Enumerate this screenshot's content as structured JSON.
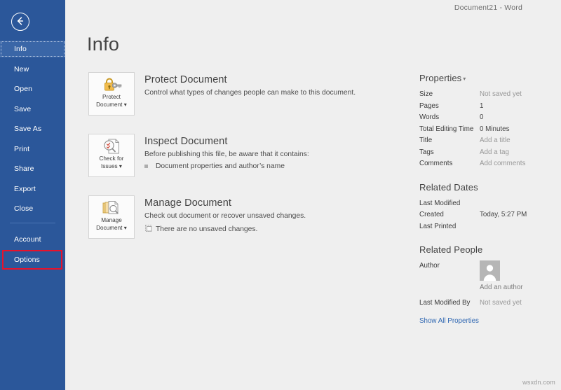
{
  "window": {
    "title": "Document21  -  Word"
  },
  "sidebar": {
    "back_icon": "back-arrow-icon",
    "items": [
      {
        "label": "Info",
        "selected": true
      },
      {
        "label": "New",
        "selected": false
      },
      {
        "label": "Open",
        "selected": false
      },
      {
        "label": "Save",
        "selected": false
      },
      {
        "label": "Save As",
        "selected": false
      },
      {
        "label": "Print",
        "selected": false
      },
      {
        "label": "Share",
        "selected": false
      },
      {
        "label": "Export",
        "selected": false
      },
      {
        "label": "Close",
        "selected": false
      }
    ],
    "bottom_items": [
      {
        "label": "Account",
        "selected": false
      },
      {
        "label": "Options",
        "selected": false,
        "highlighted": true
      }
    ],
    "highlight_color": "#e8122b",
    "background_color": "#2b579a",
    "selected_color": "#3a66a7"
  },
  "main": {
    "page_title": "Info",
    "cards": [
      {
        "button_label_line1": "Protect",
        "button_label_line2": "Document",
        "button_caret": "▾",
        "icon": "lock-key-icon",
        "heading": "Protect Document",
        "description": "Control what types of changes people can make to this document.",
        "note": null,
        "note_marker": null
      },
      {
        "button_label_line1": "Check for",
        "button_label_line2": "Issues",
        "button_caret": "▾",
        "icon": "document-inspect-icon",
        "heading": "Inspect Document",
        "description": "Before publishing this file, be aware that it contains:",
        "note": "Document properties and author’s name",
        "note_marker": "square-bullet-icon"
      },
      {
        "button_label_line1": "Manage",
        "button_label_line2": "Document",
        "button_caret": "▾",
        "icon": "manage-documents-icon",
        "heading": "Manage Document",
        "description": "Check out document or recover unsaved changes.",
        "note": "There are no unsaved changes.",
        "note_marker": "document-recover-icon"
      }
    ]
  },
  "properties_panel": {
    "properties": {
      "heading": "Properties",
      "caret": "▾",
      "rows": [
        {
          "label": "Size",
          "value": "Not saved yet",
          "placeholder": true
        },
        {
          "label": "Pages",
          "value": "1",
          "placeholder": false
        },
        {
          "label": "Words",
          "value": "0",
          "placeholder": false
        },
        {
          "label": "Total Editing Time",
          "value": "0 Minutes",
          "placeholder": false
        },
        {
          "label": "Title",
          "value": "Add a title",
          "placeholder": true
        },
        {
          "label": "Tags",
          "value": "Add a tag",
          "placeholder": true
        },
        {
          "label": "Comments",
          "value": "Add comments",
          "placeholder": true
        }
      ]
    },
    "related_dates": {
      "heading": "Related Dates",
      "rows": [
        {
          "label": "Last Modified",
          "value": "",
          "placeholder": false
        },
        {
          "label": "Created",
          "value": "Today, 5:27 PM",
          "placeholder": false
        },
        {
          "label": "Last Printed",
          "value": "",
          "placeholder": false
        }
      ]
    },
    "related_people": {
      "heading": "Related People",
      "author_label": "Author",
      "avatar_icon": "person-avatar-icon",
      "add_author": "Add an author",
      "last_modified_by_label": "Last Modified By",
      "last_modified_by_value": "Not saved yet",
      "show_all_properties": "Show All Properties",
      "link_color": "#2f67b2"
    }
  },
  "watermark": "wsxdn.com"
}
